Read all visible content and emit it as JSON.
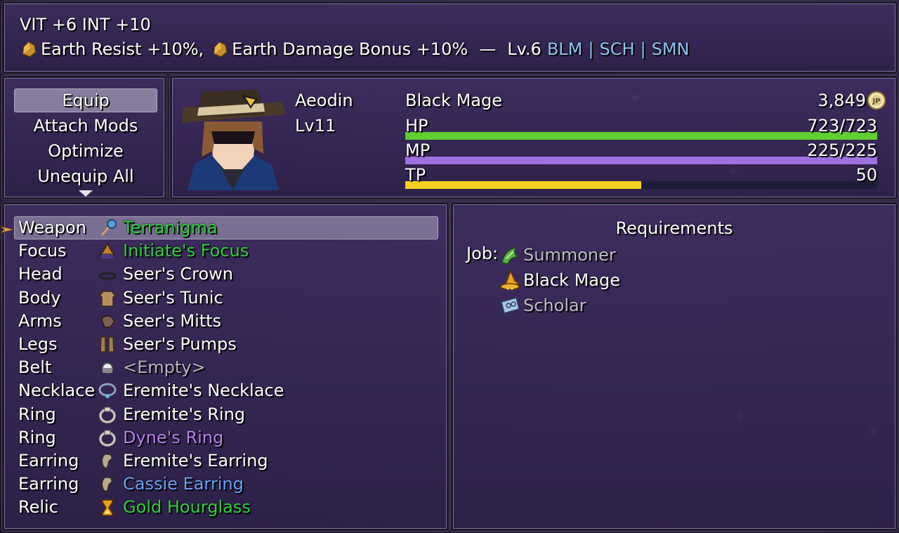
{
  "help": {
    "stats": "VIT +6 INT +10",
    "bonus1": "Earth Resist +10%,",
    "bonus2": "Earth Damage Bonus +10%",
    "dash": "—",
    "level": "Lv.6",
    "jobs": [
      "BLM",
      "SCH",
      "SMN"
    ],
    "sep": "|"
  },
  "commands": [
    "Equip",
    "Attach Mods",
    "Optimize",
    "Unequip All"
  ],
  "status": {
    "name": "Aeodin",
    "level": "Lv11",
    "class": "Black Mage",
    "jp": "3,849",
    "hp_label": "HP",
    "hp_value": "723/723",
    "hp_fraction": 1.0,
    "mp_label": "MP",
    "mp_value": "225/225",
    "mp_fraction": 1.0,
    "tp_label": "TP",
    "tp_value": "50",
    "tp_fraction": 0.5,
    "colors": {
      "hp": "#5fd030",
      "mp": "#a070e0",
      "tp": "#f5d020"
    }
  },
  "slots": [
    {
      "slot": "Weapon",
      "item": "Terranigma",
      "icon": "wand-icon",
      "color": "#30d040"
    },
    {
      "slot": "Focus",
      "item": "Initiate's Focus",
      "icon": "focus-icon",
      "color": "#30d040"
    },
    {
      "slot": "Head",
      "item": "Seer's Crown",
      "icon": "crown-icon",
      "color": "#ffffff"
    },
    {
      "slot": "Body",
      "item": "Seer's Tunic",
      "icon": "tunic-icon",
      "color": "#ffffff"
    },
    {
      "slot": "Arms",
      "item": "Seer's Mitts",
      "icon": "mitts-icon",
      "color": "#ffffff"
    },
    {
      "slot": "Legs",
      "item": "Seer's Pumps",
      "icon": "boots-icon",
      "color": "#ffffff"
    },
    {
      "slot": "Belt",
      "item": "<Empty>",
      "icon": "empty-icon",
      "color": "#b8b4c4"
    },
    {
      "slot": "Necklace",
      "item": "Eremite's Necklace",
      "icon": "necklace-icon",
      "color": "#ffffff"
    },
    {
      "slot": "Ring",
      "item": "Eremite's Ring",
      "icon": "ring-icon",
      "color": "#ffffff"
    },
    {
      "slot": "Ring",
      "item": "Dyne's Ring",
      "icon": "ring-icon",
      "color": "#b87ff0"
    },
    {
      "slot": "Earring",
      "item": "Eremite's Earring",
      "icon": "earring-icon",
      "color": "#ffffff"
    },
    {
      "slot": "Earring",
      "item": "Cassie Earring",
      "icon": "earring-icon",
      "color": "#6aa0f5"
    },
    {
      "slot": "Relic",
      "item": "Gold Hourglass",
      "icon": "hourglass-icon",
      "color": "#30d040"
    }
  ],
  "requirements": {
    "title": "Requirements",
    "job_label": "Job:",
    "jobs": [
      {
        "name": "Summoner",
        "icon": "summoner-icon",
        "color": "#c0bcc8"
      },
      {
        "name": "Black Mage",
        "icon": "black-mage-icon",
        "color": "#ffffff"
      },
      {
        "name": "Scholar",
        "icon": "scholar-icon",
        "color": "#c0bcc8"
      }
    ]
  }
}
